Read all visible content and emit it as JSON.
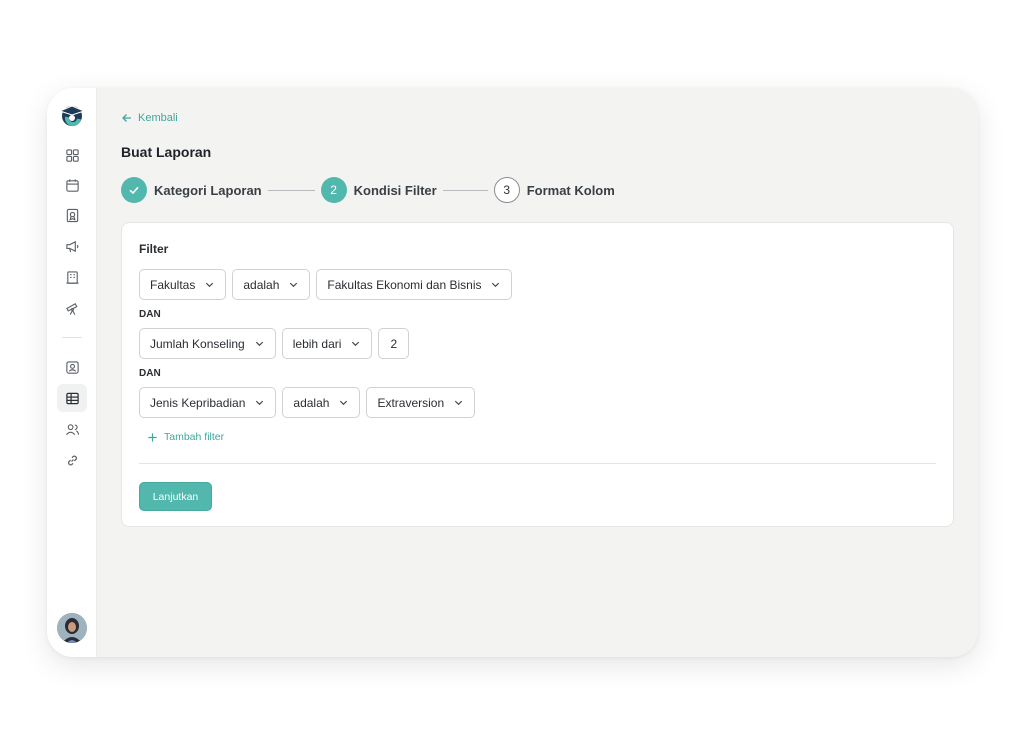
{
  "nav": {
    "back_label": "Kembali"
  },
  "page": {
    "title": "Buat Laporan"
  },
  "stepper": {
    "steps": [
      {
        "number": "1",
        "label": "Kategori Laporan",
        "state": "done"
      },
      {
        "number": "2",
        "label": "Kondisi Filter",
        "state": "current"
      },
      {
        "number": "3",
        "label": "Format Kolom",
        "state": "todo"
      }
    ]
  },
  "filter": {
    "title": "Filter",
    "conjunction": "DAN",
    "rows": [
      {
        "field": "Fakultas",
        "operator": "adalah",
        "value": "Fakultas Ekonomi dan Bisnis",
        "value_type": "select"
      },
      {
        "field": "Jumlah Konseling",
        "operator": "lebih dari",
        "value": "2",
        "value_type": "input"
      },
      {
        "field": "Jenis Kepribadian",
        "operator": "adalah",
        "value": "Extraversion",
        "value_type": "select"
      }
    ],
    "add_label": "Tambah filter",
    "continue_label": "Lanjutkan"
  },
  "sidebar": {
    "icons": [
      "dashboard-icon",
      "calendar-icon",
      "certificate-icon",
      "megaphone-icon",
      "building-icon",
      "telescope-icon",
      "contact-card-icon",
      "table-icon",
      "users-icon",
      "link-icon"
    ],
    "active": "table-icon"
  },
  "colors": {
    "accent": "#52b7ad",
    "accent_text": "#3fa89c",
    "logo_dark": "#1e3a56"
  }
}
